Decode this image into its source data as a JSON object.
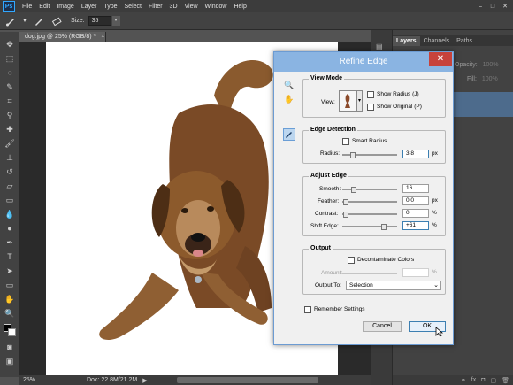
{
  "menubar": {
    "logo": "Ps",
    "items": [
      "File",
      "Edit",
      "Image",
      "Layer",
      "Type",
      "Select",
      "Filter",
      "3D",
      "View",
      "Window",
      "Help"
    ],
    "min": "–",
    "max": "□",
    "close": "✕"
  },
  "options": {
    "size_label": "Size:",
    "size_value": "35"
  },
  "document": {
    "tab_label": "dog.jpg @ 25% (RGB/8) *",
    "tab_close": "×",
    "zoom": "25%",
    "doc_info": "Doc: 22.8M/21.2M",
    "arrow": "▶"
  },
  "panels": {
    "tabs": [
      "Layers",
      "Channels",
      "Paths"
    ],
    "opacity_label": "Opacity:",
    "opacity_value": "100%",
    "fill_label": "Fill:",
    "fill_value": "100%"
  },
  "dialog": {
    "title": "Refine Edge",
    "close": "✕",
    "view_mode": {
      "title": "View Mode",
      "view_label": "View:",
      "show_radius": "Show Radius (J)",
      "show_original": "Show Original (P)"
    },
    "edge_detection": {
      "title": "Edge Detection",
      "smart_radius": "Smart Radius",
      "radius_label": "Radius:",
      "radius_value": "3.8",
      "radius_unit": "px",
      "radius_level": 0.15
    },
    "adjust_edge": {
      "title": "Adjust Edge",
      "smooth_label": "Smooth:",
      "smooth_value": "16",
      "smooth_level": 0.16,
      "feather_label": "Feather:",
      "feather_value": "0.0",
      "feather_unit": "px",
      "feather_level": 0.0,
      "contrast_label": "Contrast:",
      "contrast_value": "0",
      "contrast_unit": "%",
      "contrast_level": 0.0,
      "shift_label": "Shift Edge:",
      "shift_value": "+61",
      "shift_unit": "%",
      "shift_level": 0.8
    },
    "output": {
      "title": "Output",
      "decontaminate": "Decontaminate Colors",
      "amount_label": "Amount:",
      "amount_unit": "%",
      "output_to_label": "Output To:",
      "output_to_value": "Selection"
    },
    "remember": "Remember Settings",
    "cancel": "Cancel",
    "ok": "OK"
  }
}
